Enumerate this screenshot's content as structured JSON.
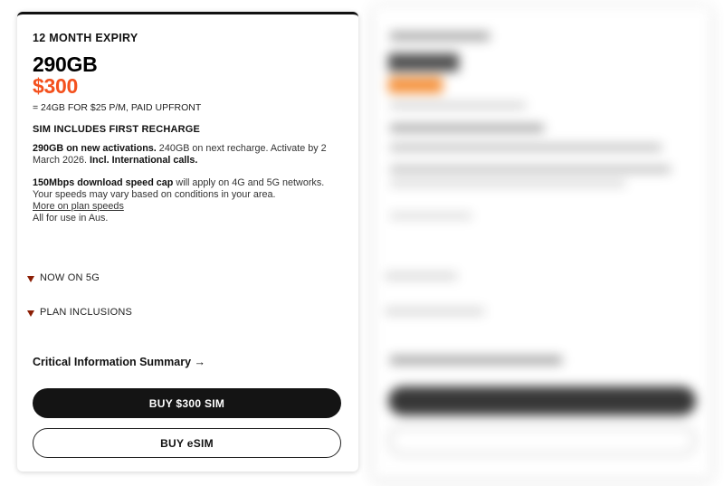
{
  "plan": {
    "expiry": "12 MONTH EXPIRY",
    "data_amount": "290GB",
    "price": "$300",
    "per_month": "= 24GB FOR $25 P/M, PAID UPFRONT",
    "sim_includes": "SIM INCLUDES FIRST RECHARGE",
    "activation_bold": "290GB on new activations.",
    "activation_text": " 240GB on next recharge. Activate by 2 March 2026. ",
    "international_bold": "Incl. International calls.",
    "speed_bold": "150Mbps download speed cap",
    "speed_text": " will apply on 4G and 5G networks. Your speeds may vary based on conditions in your area.",
    "speed_link": "More on plan speeds",
    "aus_text": "All for use in Aus.",
    "accordion_5g": "NOW ON 5G",
    "accordion_inclusions": "PLAN INCLUSIONS",
    "cis_label": "Critical Information Summary →",
    "buy_sim_label": "BUY $300 SIM",
    "buy_esim_label": "BUY eSIM"
  },
  "colors": {
    "accent": "#f4511e",
    "triangle": "#8b1e05",
    "button_dark": "#141414"
  },
  "icons": {
    "accordion": "triangle-down-icon",
    "cis_arrow": "arrow-right-icon"
  }
}
